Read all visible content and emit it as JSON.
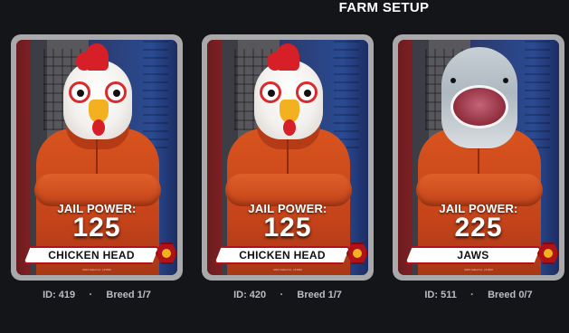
{
  "title": "FARM SETUP",
  "cards": [
    {
      "jail_power_label": "JAIL POWER:",
      "jail_power_value": "125",
      "name": "CHICKEN HEAD",
      "fine_print": "2023 Jailed Inc. | #1810",
      "id_label": "ID: 419",
      "separator": "·",
      "breed_label": "Breed 1/7",
      "mask": "chicken-mask"
    },
    {
      "jail_power_label": "JAIL POWER:",
      "jail_power_value": "125",
      "name": "CHICKEN HEAD",
      "fine_print": "2023 Jailed Inc. | #1810",
      "id_label": "ID: 420",
      "separator": "·",
      "breed_label": "Breed 1/7",
      "mask": "chicken-mask"
    },
    {
      "jail_power_label": "JAIL POWER:",
      "jail_power_value": "225",
      "name": "JAWS",
      "fine_print": "2023 Jailed Inc. | #1810",
      "id_label": "ID: 511",
      "separator": "·",
      "breed_label": "Breed 0/7",
      "mask": "shark-mask"
    }
  ],
  "colors": {
    "background": "#141519",
    "card_frame": "#a9a9ab",
    "nameplate_border": "#b1121a",
    "badge": "#b1121a",
    "jumpsuit": "#d8541e",
    "meta_text": "#b9bcc2"
  }
}
